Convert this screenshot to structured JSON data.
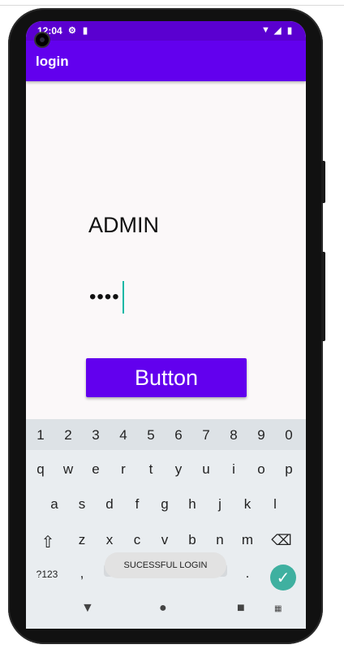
{
  "status_bar": {
    "time": "12:04",
    "icons": [
      "camera-icon",
      "settings-icon",
      "sd-card-icon",
      "wifi-icon",
      "signal-icon",
      "battery-icon"
    ]
  },
  "app_bar": {
    "title": "login"
  },
  "form": {
    "username_value": "ADMIN",
    "password_value": "••••",
    "button_label": "Button"
  },
  "keyboard": {
    "number_row": [
      "1",
      "2",
      "3",
      "4",
      "5",
      "6",
      "7",
      "8",
      "9",
      "0"
    ],
    "row1": [
      "q",
      "w",
      "e",
      "r",
      "t",
      "y",
      "u",
      "i",
      "o",
      "p"
    ],
    "row2": [
      "a",
      "s",
      "d",
      "f",
      "g",
      "h",
      "j",
      "k",
      "l"
    ],
    "row3": [
      "z",
      "x",
      "c",
      "v",
      "b",
      "n",
      "m"
    ],
    "symbols_label": "?123",
    "comma": ",",
    "period": "."
  },
  "toast": {
    "text": "SUCESSFUL LOGIN"
  },
  "colors": {
    "primary": "#6200ee",
    "primary_dark": "#5a00d0",
    "accent": "#3fb0a0"
  }
}
